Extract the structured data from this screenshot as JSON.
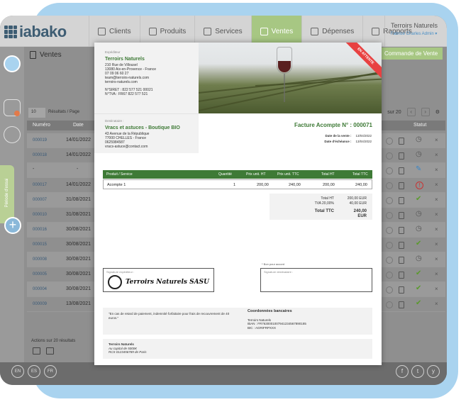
{
  "app": {
    "logo": "iabako",
    "user_name": "Terroirs Naturels",
    "user_role": "Fabrice Charles Admin ▾"
  },
  "nav": [
    {
      "label": "Clients",
      "icon": "user-icon"
    },
    {
      "label": "Produits",
      "icon": "tag-icon"
    },
    {
      "label": "Services",
      "icon": "briefcase-icon"
    },
    {
      "label": "Ventes",
      "icon": "sales-icon",
      "active": true
    },
    {
      "label": "Dépenses",
      "icon": "receipt-icon"
    },
    {
      "label": "Rapports",
      "icon": "chart-icon"
    }
  ],
  "rail": {
    "tab_label": "Période d'essai"
  },
  "list": {
    "title": "Ventes",
    "new_button": "Commande de Vente",
    "per_page": "10",
    "per_page_label": "Résultats / Page",
    "pager_text": "sur 20",
    "columns": {
      "num": "Numéro",
      "date": "Date",
      "status": "Statut"
    },
    "rows": [
      {
        "num": "000019",
        "date": "14/01/2022",
        "status": "clock"
      },
      {
        "num": "000018",
        "date": "14/01/2022",
        "status": "clock"
      },
      {
        "num": "-",
        "date": "-",
        "status": "edit"
      },
      {
        "num": "000017",
        "date": "14/01/2022",
        "status": "warn"
      },
      {
        "num": "000007",
        "date": "31/08/2021",
        "status": "check"
      },
      {
        "num": "000010",
        "date": "31/08/2021",
        "status": "clock"
      },
      {
        "num": "000016",
        "date": "30/08/2021",
        "status": "clock"
      },
      {
        "num": "000015",
        "date": "30/08/2021",
        "status": "check"
      },
      {
        "num": "000008",
        "date": "30/08/2021",
        "status": "clock"
      },
      {
        "num": "000005",
        "date": "30/08/2021",
        "status": "check"
      },
      {
        "num": "000004",
        "date": "30/08/2021",
        "status": "check"
      },
      {
        "num": "000009",
        "date": "13/08/2021",
        "status": "check"
      }
    ],
    "bulk_label": "Actions sur 20 résultats"
  },
  "footer": {
    "langs": [
      "EN",
      "ES",
      "FR"
    ],
    "socials": [
      "f",
      "t",
      "y"
    ]
  },
  "invoice": {
    "issuer_label": "Expéditeur",
    "issuer_name": "Terroirs Naturels",
    "issuer_lines": [
      "210 Rue de Villousel",
      "13080 Aix-en-Provence - France",
      "07 09 06 60 27",
      "team@terroirs-naturels.com",
      "terroirs-naturels.com"
    ],
    "issuer_ids": [
      "N°SIRET : 822 577 521 00021",
      "N°TVA : FR67 822 577 521"
    ],
    "ribbon": "EN ATTENTE",
    "dest_label": "Destinataire :",
    "dest_name": "Vracs et astuces - Boutique BIO",
    "dest_lines": [
      "43 Avenue de la République",
      "77000 CHELLES - France",
      "0625984587",
      "vracs-astuce@contact.com"
    ],
    "title": "Facture Acompte N° : 000071",
    "meta": [
      {
        "k": "Date de la vente :",
        "v": "13/04/2022"
      },
      {
        "k": "Date d'échéance :",
        "v": "13/04/2022"
      }
    ],
    "cols": [
      "Produit / Service",
      "Quantité",
      "Prix unit. HT",
      "Prix unit. TTC",
      "Total HT",
      "Total TTC"
    ],
    "line": {
      "name": "Acompte 1",
      "qty": "1",
      "pu_ht": "200,00",
      "pu_ttc": "240,00",
      "t_ht": "200,00",
      "t_ttc": "240,00"
    },
    "totals": [
      {
        "k": "Total HT",
        "v": "200,00 EUR"
      },
      {
        "k": "TVA 20,00%",
        "v": "40,00 EUR"
      }
    ],
    "total_ttc_label": "Total TTC",
    "total_ttc": "240,00 EUR",
    "sign_issuer_label": "Signature expéditeur :",
    "stamp_text": "Terroirs Naturels SASU",
    "bon_label": "* Bon pour accord",
    "sign_dest_label": "Signature destinataire :",
    "legal": "\"En cas de retard de paiement, indemnité forfaitaire pour frais de recouvrement de 40 euros.\"",
    "bank_title": "Coordonnées bancaires",
    "bank_lines": [
      "Terroirs Naturels",
      "IBAN : FR7630001007941234567890185",
      "BIC : AGRIFRPXXX"
    ],
    "foot_name": "Terroirs Naturels",
    "foot_capital": "Au capital de 5000€",
    "foot_rcs": "RCS 0123456789 de Paris"
  }
}
